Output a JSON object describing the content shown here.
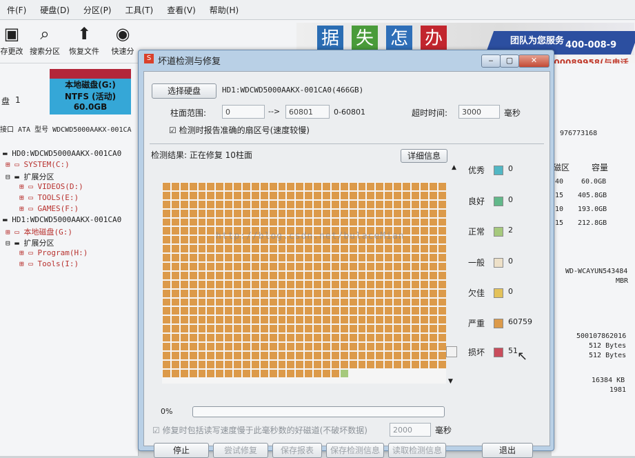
{
  "menubar": {
    "items": [
      "件(F)",
      "硬盘(D)",
      "分区(P)",
      "工具(T)",
      "查看(V)",
      "帮助(H)"
    ]
  },
  "toolbar": {
    "buttons": [
      {
        "label": "存更改",
        "icon": "save-icon"
      },
      {
        "label": "搜索分区",
        "icon": "search-icon"
      },
      {
        "label": "恢复文件",
        "icon": "restore-icon"
      },
      {
        "label": "快速分",
        "icon": "disk-icon"
      }
    ]
  },
  "banner": {
    "chars": [
      "据",
      "失",
      "怎",
      "办"
    ],
    "text": "团队为您服务",
    "phone": "400-008-9",
    "hotline": "000089958(与电话"
  },
  "left": {
    "disk_card": {
      "line1": "本地磁盘(G:)",
      "line2": "NTFS (活动)",
      "line3": "60.0GB"
    },
    "disk_label": "盘",
    "disk_num": "1",
    "interface": "接口 ATA   型号 WDCWD5000AAKX-001CA",
    "tree": [
      "HD0:WDCWD5000AAKX-001CA0",
      "SYSTEM(C:)",
      "扩展分区",
      "VIDEOS(D:)",
      "TOOLS(E:)",
      "GAMES(F:)",
      "HD1:WDCWD5000AAKX-001CA0",
      "本地磁盘(G:)",
      "扩展分区",
      "Program(H:)",
      "Tools(I:)"
    ]
  },
  "right": {
    "header_partition": "磁区",
    "header_capacity": "容量",
    "rows": [
      [
        "40",
        "60.0GB"
      ],
      [
        "15",
        "405.8GB"
      ],
      [
        "10",
        "193.0GB"
      ],
      [
        "15",
        "212.8GB"
      ]
    ],
    "sectors": "976773168",
    "serial": "WD-WCAYUN543484",
    "scheme": "MBR",
    "bytes_total": "500107862016",
    "sector_size1": "512 Bytes",
    "sector_size2": "512 Bytes",
    "cache": "16384 KB",
    "year": "1981"
  },
  "dialog": {
    "title": "坏道检测与修复",
    "select_disk_label": "选择硬盘",
    "disk_name": "HD1:WDCWD5000AAKX-001CA0(466GB)",
    "cyl_range_label": "柱面范围:",
    "cyl_from": "0",
    "cyl_sep": "-->",
    "cyl_to": "60801",
    "cyl_hint": "0-60801",
    "timeout_label": "超时时间:",
    "timeout_value": "3000",
    "timeout_unit": "毫秒",
    "report_checkbox": "检测时报告准确的扇区号(速度较慢)",
    "result_label": "检测结果: 正在修复 10柱面",
    "details_button": "详细信息",
    "legend": [
      {
        "label": "优秀",
        "count": "0",
        "color": "#52b7c4"
      },
      {
        "label": "良好",
        "count": "0",
        "color": "#62b88a"
      },
      {
        "label": "正常",
        "count": "2",
        "color": "#a6c97d"
      },
      {
        "label": "一般",
        "count": "0",
        "color": "#ede0c8"
      },
      {
        "label": "欠佳",
        "count": "0",
        "color": "#e3c25a"
      },
      {
        "label": "严重",
        "count": "60759",
        "color": "#dc9a4a"
      },
      {
        "label": "损坏",
        "count": "51",
        "color": "#c94d5c"
      }
    ],
    "progress_label": "0%",
    "progress_fraction": 0,
    "repair_checkbox": "修复时包括读写速度慢于此毫秒数的好磁道(不破坏数据)",
    "repair_ms_value": "2000",
    "repair_ms_unit": "毫秒",
    "buttons": {
      "stop": "停止",
      "try_repair": "尝试修复",
      "save_report": "保存报表",
      "save_result": "保存检测信息",
      "load_result": "读取检测信息",
      "exit": "退出"
    },
    "watermark": "http://blog.csdn.net/bulaceMian"
  }
}
